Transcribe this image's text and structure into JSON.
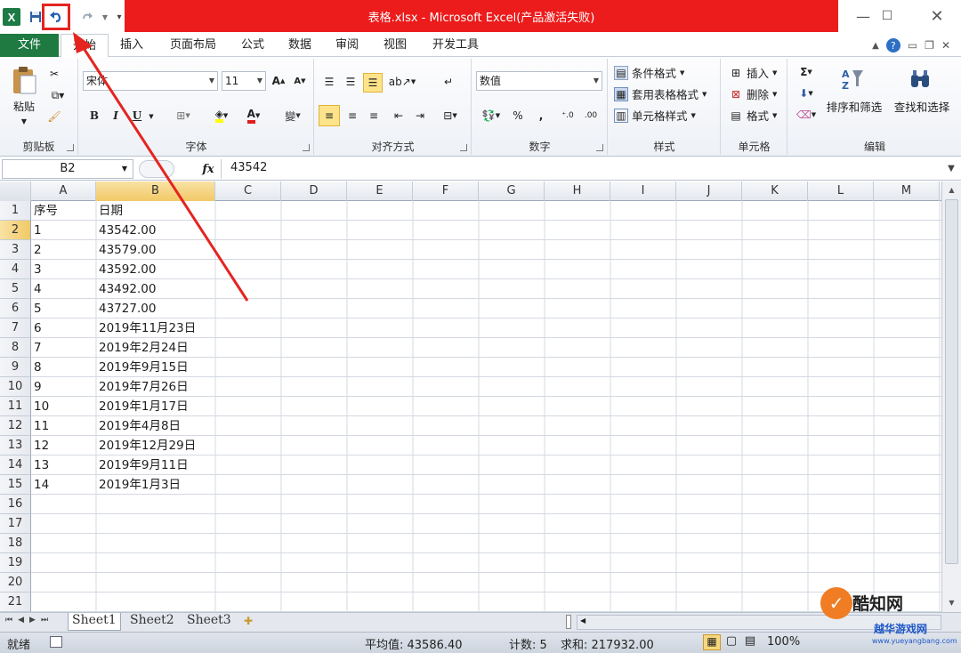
{
  "window": {
    "title": "表格.xlsx - Microsoft Excel(产品激活失败)"
  },
  "tabs": [
    {
      "label": "文件"
    },
    {
      "label": "开始"
    },
    {
      "label": "插入"
    },
    {
      "label": "页面布局"
    },
    {
      "label": "公式"
    },
    {
      "label": "数据"
    },
    {
      "label": "审阅"
    },
    {
      "label": "视图"
    },
    {
      "label": "开发工具"
    }
  ],
  "ribbon": {
    "clipboard": {
      "paste": "粘贴",
      "label": "剪贴板"
    },
    "font": {
      "name": "宋体",
      "size": "11",
      "label": "字体",
      "bold": "B",
      "italic": "I",
      "underline": "U"
    },
    "alignment": {
      "label": "对齐方式"
    },
    "number": {
      "format": "数值",
      "label": "数字",
      "percent": "%",
      "comma": ","
    },
    "styles": {
      "conditional": "条件格式",
      "table": "套用表格格式",
      "cell": "单元格样式",
      "label": "样式"
    },
    "cells": {
      "insert": "插入",
      "delete": "删除",
      "format": "格式",
      "label": "单元格"
    },
    "editing": {
      "sigma": "Σ",
      "sort": "排序和筛选",
      "find": "查找和选择",
      "label": "编辑"
    }
  },
  "formula_bar": {
    "name_box": "B2",
    "fx": "fx",
    "value": "43542"
  },
  "columns": [
    "A",
    "B",
    "C",
    "D",
    "E",
    "F",
    "G",
    "H",
    "I",
    "J",
    "K",
    "L",
    "M"
  ],
  "rows": [
    "1",
    "2",
    "3",
    "4",
    "5",
    "6",
    "7",
    "8",
    "9",
    "10",
    "11",
    "12",
    "13",
    "14",
    "15",
    "16",
    "17",
    "18",
    "19",
    "20",
    "21"
  ],
  "cells": [
    [
      "序号",
      "日期"
    ],
    [
      "1",
      "43542.00"
    ],
    [
      "2",
      "43579.00"
    ],
    [
      "3",
      "43592.00"
    ],
    [
      "4",
      "43492.00"
    ],
    [
      "5",
      "43727.00"
    ],
    [
      "6",
      "2019年11月23日"
    ],
    [
      "7",
      "2019年2月24日"
    ],
    [
      "8",
      "2019年9月15日"
    ],
    [
      "9",
      "2019年7月26日"
    ],
    [
      "10",
      "2019年1月17日"
    ],
    [
      "11",
      "2019年4月8日"
    ],
    [
      "12",
      "2019年12月29日"
    ],
    [
      "13",
      "2019年9月11日"
    ],
    [
      "14",
      "2019年1月3日"
    ]
  ],
  "sheets": [
    "Sheet1",
    "Sheet2",
    "Sheet3"
  ],
  "status": {
    "ready": "就绪",
    "average": "平均值: 43586.40",
    "count": "计数: 5",
    "sum": "求和: 217932.00",
    "zoom": "100%"
  },
  "watermark": {
    "brand1": "酷知网",
    "brand2": "越华游戏网",
    "url": "www.yueyangbang.com"
  },
  "colors": {
    "file_tab": "#1f7a42",
    "title_highlight": "#ec1c1c",
    "annotation": "#e52420",
    "selection": "#f1c966"
  }
}
